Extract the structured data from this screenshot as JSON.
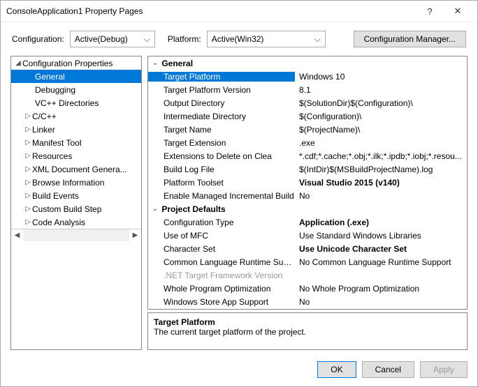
{
  "window": {
    "title": "ConsoleApplication1 Property Pages"
  },
  "top": {
    "config_label": "Configuration:",
    "config_value": "Active(Debug)",
    "platform_label": "Platform:",
    "platform_value": "Active(Win32)",
    "manager_button": "Configuration Manager..."
  },
  "tree": {
    "root": "Configuration Properties",
    "items": [
      {
        "label": "General",
        "sel": true,
        "expander": ""
      },
      {
        "label": "Debugging",
        "expander": ""
      },
      {
        "label": "VC++ Directories",
        "expander": ""
      },
      {
        "label": "C/C++",
        "expander": "▷"
      },
      {
        "label": "Linker",
        "expander": "▷"
      },
      {
        "label": "Manifest Tool",
        "expander": "▷"
      },
      {
        "label": "Resources",
        "expander": "▷"
      },
      {
        "label": "XML Document Genera...",
        "expander": "▷"
      },
      {
        "label": "Browse Information",
        "expander": "▷"
      },
      {
        "label": "Build Events",
        "expander": "▷"
      },
      {
        "label": "Custom Build Step",
        "expander": "▷"
      },
      {
        "label": "Code Analysis",
        "expander": "▷"
      }
    ]
  },
  "grid": {
    "section1": "General",
    "rows1": [
      {
        "k": "Target Platform",
        "v": "Windows 10",
        "sel": true
      },
      {
        "k": "Target Platform Version",
        "v": "8.1"
      },
      {
        "k": "Output Directory",
        "v": "$(SolutionDir)$(Configuration)\\"
      },
      {
        "k": "Intermediate Directory",
        "v": "$(Configuration)\\"
      },
      {
        "k": "Target Name",
        "v": "$(ProjectName)\\"
      },
      {
        "k": "Target Extension",
        "v": ".exe"
      },
      {
        "k": "Extensions to Delete on Clea",
        "v": "*.cdf;*.cache;*.obj;*.ilk;*.ipdb;*.iobj;*.resou..."
      },
      {
        "k": "Build Log File",
        "v": "$(IntDir)$(MSBuildProjectName).log"
      },
      {
        "k": "Platform Toolset",
        "v": "Visual Studio 2015 (v140)",
        "bold": true
      },
      {
        "k": "Enable Managed Incremental Build",
        "v": "No"
      }
    ],
    "section2": "Project Defaults",
    "rows2": [
      {
        "k": "Configuration Type",
        "v": "Application (.exe)",
        "bold": true
      },
      {
        "k": "Use of MFC",
        "v": "Use Standard Windows Libraries"
      },
      {
        "k": "Character Set",
        "v": "Use Unicode Character Set",
        "bold": true
      },
      {
        "k": "Common Language Runtime Sup...",
        "v": "No Common Language Runtime Support"
      },
      {
        "k": ".NET Target Framework Version",
        "v": "",
        "disabled": true
      },
      {
        "k": "Whole Program Optimization",
        "v": "No Whole Program Optimization"
      },
      {
        "k": "Windows Store App Support",
        "v": "No"
      }
    ]
  },
  "desc": {
    "heading": "Target Platform",
    "text": "The current target platform of the project."
  },
  "footer": {
    "ok": "OK",
    "cancel": "Cancel",
    "apply": "Apply"
  },
  "glyph": {
    "close": "✕",
    "help": "?",
    "caret": "⌵",
    "tri_open": "◢",
    "tri_closed": "▷",
    "left": "◀",
    "right": "▶"
  }
}
